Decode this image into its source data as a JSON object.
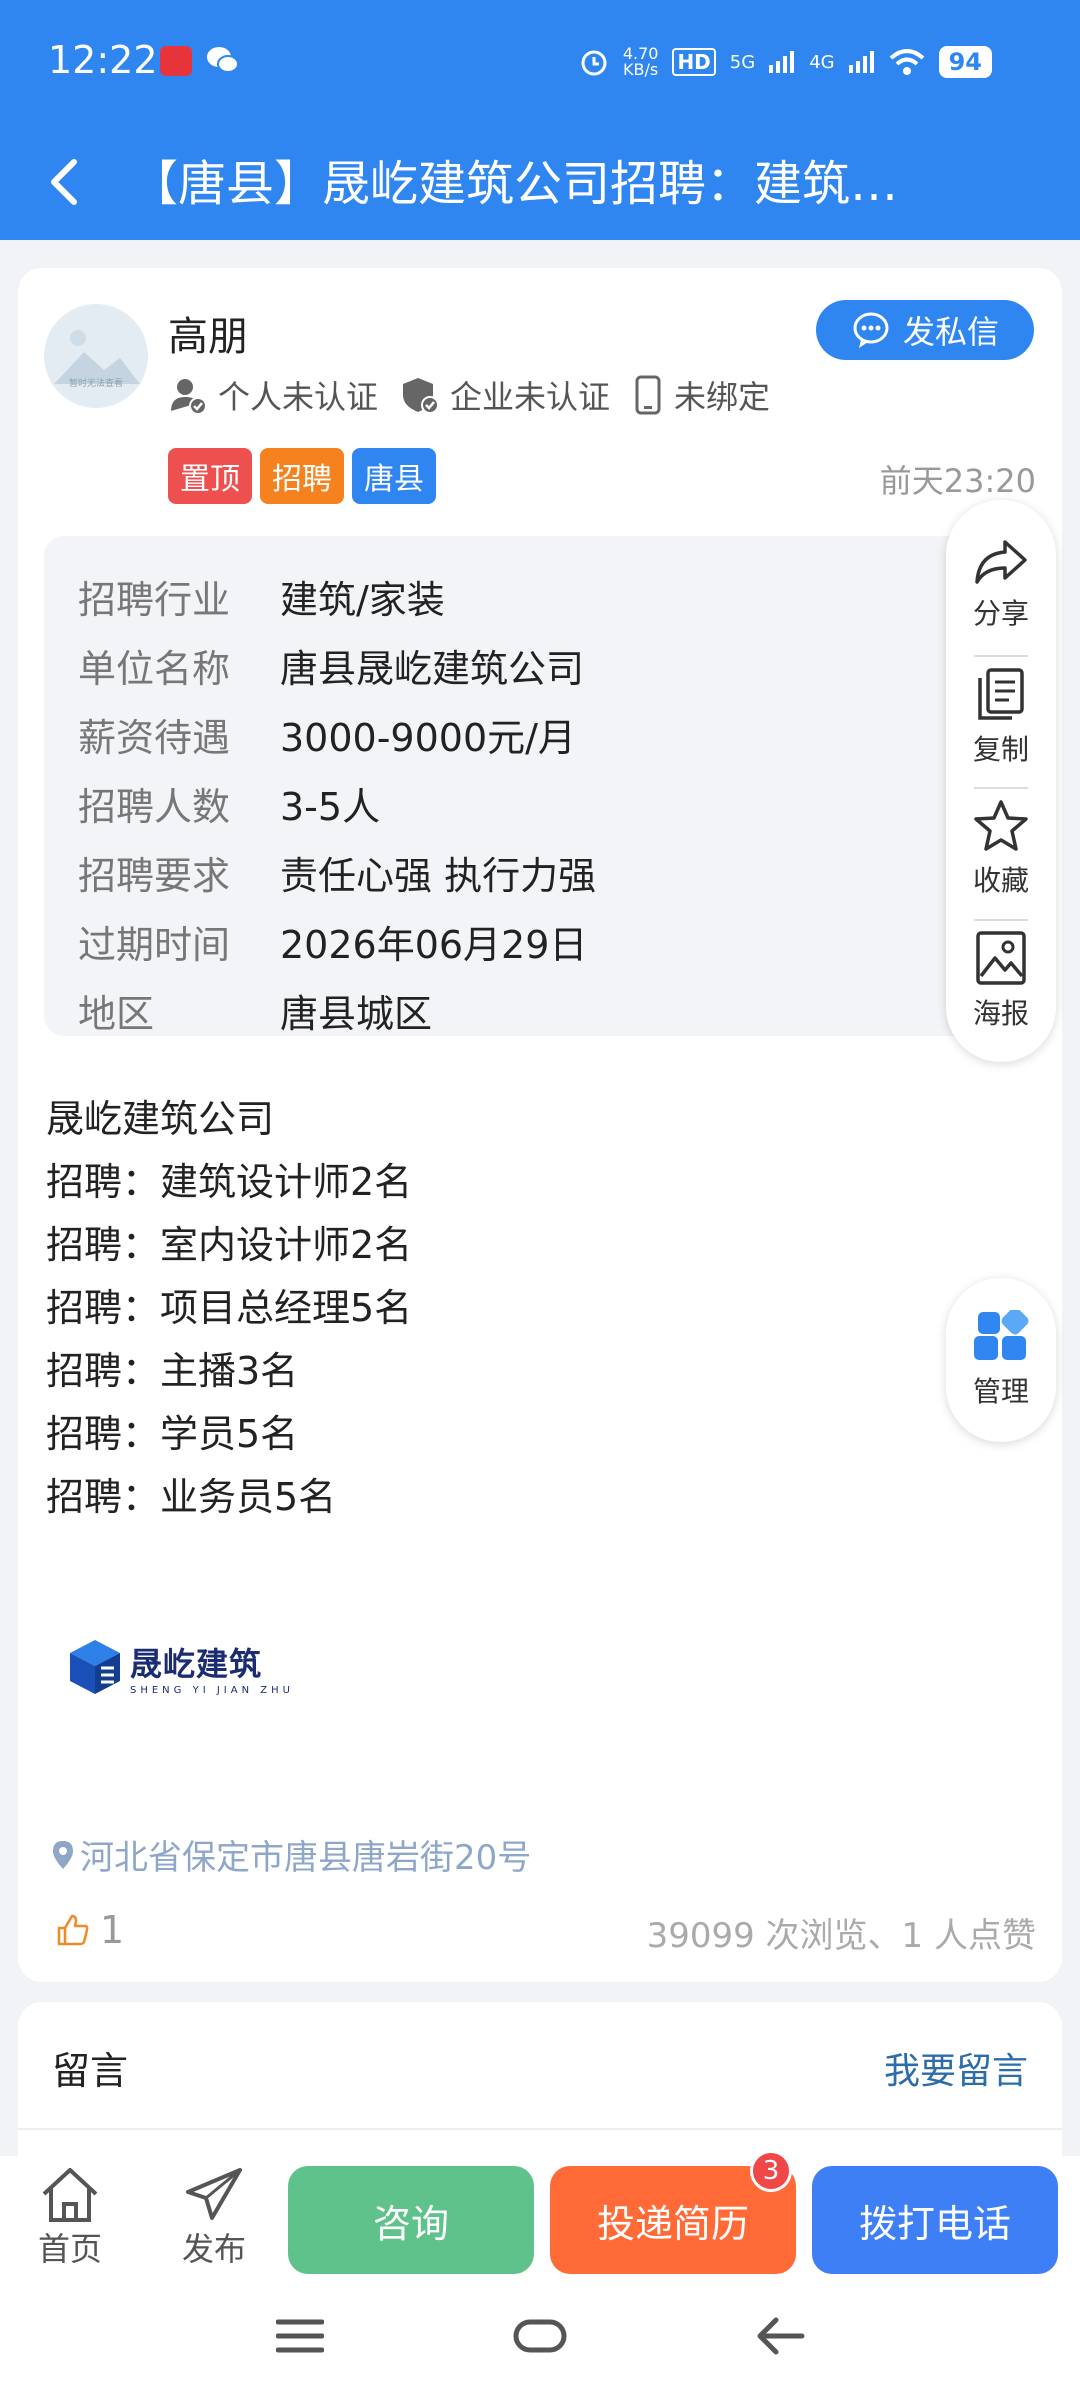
{
  "status_bar": {
    "time": "12:22",
    "net_speed_top": "4.70",
    "net_speed_bottom": "KB/s",
    "hd_label": "HD",
    "sig1": "5G",
    "sig2": "4G",
    "battery": "94"
  },
  "nav": {
    "title": "【唐县】晟屹建筑公司招聘：建筑…"
  },
  "poster": {
    "name": "高朋",
    "dm_label": "发私信",
    "personal_cert": "个人未认证",
    "company_cert": "企业未认证",
    "phone_bind": "未绑定",
    "avatar_caption": "暂时无法查看",
    "tags": [
      "置顶",
      "招聘",
      "唐县"
    ],
    "posted_time": "前天23:20"
  },
  "info": [
    {
      "k": "招聘行业",
      "v": "建筑/家装"
    },
    {
      "k": "单位名称",
      "v": "唐县晟屹建筑公司"
    },
    {
      "k": "薪资待遇",
      "v": "3000-9000元/月"
    },
    {
      "k": "招聘人数",
      "v": "3-5人"
    },
    {
      "k": "招聘要求",
      "v": "责任心强 执行力强"
    },
    {
      "k": "过期时间",
      "v": "2026年06月29日"
    },
    {
      "k": "地区",
      "v": "唐县城区"
    }
  ],
  "description": [
    "晟屹建筑公司",
    "招聘：建筑设计师2名",
    "招聘：室内设计师2名",
    "招聘：项目总经理5名",
    "招聘：主播3名",
    "招聘：学员5名",
    "招聘：业务员5名"
  ],
  "logo": {
    "name": "晟屹建筑",
    "sub": "SHENG YI JIAN ZHU"
  },
  "address": "河北省保定市唐县唐岩街20号",
  "likes": "1",
  "stats": "39099 次浏览、1 人点赞",
  "side_actions": {
    "share": "分享",
    "copy": "复制",
    "favorite": "收藏",
    "poster": "海报"
  },
  "manage": "管理",
  "comments": {
    "title": "留言",
    "leave": "我要留言"
  },
  "bottom": {
    "home": "首页",
    "publish": "发布",
    "consult": "咨询",
    "resume": "投递简历",
    "resume_badge": "3",
    "call": "拨打电话"
  },
  "colors": {
    "primary": "#2f86f0",
    "consult": "#5ec28a",
    "resume": "#ff6a36",
    "call": "#3e7ff5"
  }
}
